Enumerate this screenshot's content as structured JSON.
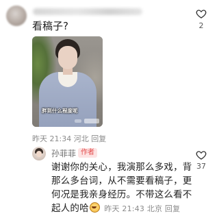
{
  "comment": {
    "text": "看稿子?",
    "likes": "2"
  },
  "video_card": {
    "subtitle": "胖到什么程度呢"
  },
  "comment_meta": {
    "time": "昨天 21:34",
    "location": "河北",
    "reply_label": "回复"
  },
  "reply": {
    "author": "孙菲菲",
    "author_tag": "作者",
    "text": "谢谢你的关心，我演那么多戏，背那么多台词，从不需要看稿子，更何况是我亲身经历。不带这么看不起人的哈",
    "time": "昨天 21:43",
    "location": "北京",
    "reply_label": "回复",
    "likes": "37"
  },
  "icons": {
    "like": "heart-outline-icon",
    "emoji": "laughing-emoji-icon"
  }
}
